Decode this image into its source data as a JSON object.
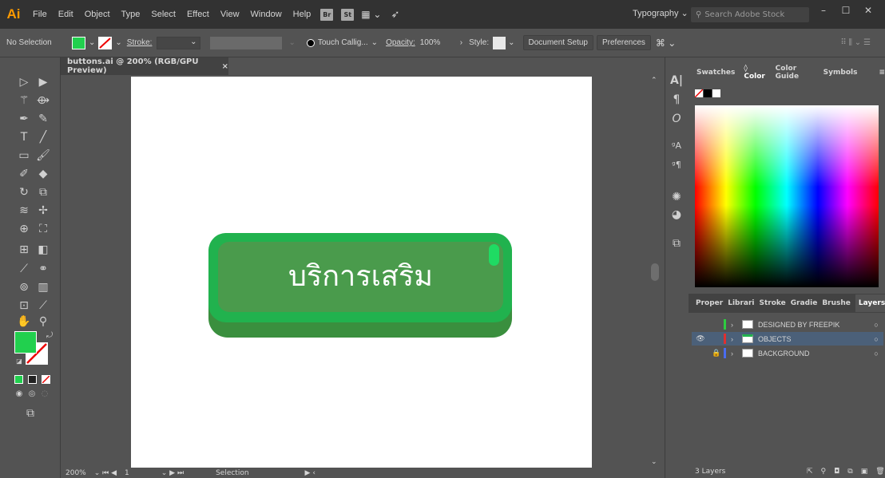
{
  "app": {
    "logo": "Ai"
  },
  "menubar": {
    "items": [
      "File",
      "Edit",
      "Object",
      "Type",
      "Select",
      "Effect",
      "View",
      "Window",
      "Help"
    ],
    "br": "Br",
    "st": "St",
    "workspace": "Typography",
    "search_placeholder": "Search Adobe Stock"
  },
  "controlbar": {
    "selection": "No Selection",
    "stroke_label": "Stroke:",
    "brush": "Touch Callig...",
    "opacity_label": "Opacity:",
    "opacity_value": "100%",
    "style_label": "Style:",
    "doc_setup": "Document Setup",
    "preferences": "Preferences",
    "fill_color": "#21d04e"
  },
  "document": {
    "tab_title": "buttons.ai @ 200% (RGB/GPU Preview)",
    "close": "×",
    "zoom": "200%",
    "page": "1",
    "status": "Selection"
  },
  "artwork": {
    "button_text": "บริการเสริม",
    "colors": {
      "top": "#21b24e",
      "inner": "#4a9b4c",
      "base": "#3a8f3e",
      "glint": "#1fdb63"
    }
  },
  "color_panel": {
    "tabs": [
      "Swatches",
      "Color",
      "Color Guide",
      "Symbols"
    ],
    "active_tab": "Color"
  },
  "layers_panel": {
    "tabs": [
      "Proper",
      "Librari",
      "Stroke",
      "Gradie",
      "Brushe",
      "Layers"
    ],
    "active_tab": "Layers",
    "layers": [
      {
        "name": "DESIGNED BY FREEPIK",
        "color": "#2ecc40",
        "visible": false,
        "locked": false,
        "selected": false
      },
      {
        "name": "OBJECTS",
        "color": "#e03030",
        "visible": true,
        "locked": false,
        "selected": true
      },
      {
        "name": "BACKGROUND",
        "color": "#4a6cf0",
        "visible": false,
        "locked": true,
        "selected": false
      }
    ],
    "count": "3 Layers"
  }
}
